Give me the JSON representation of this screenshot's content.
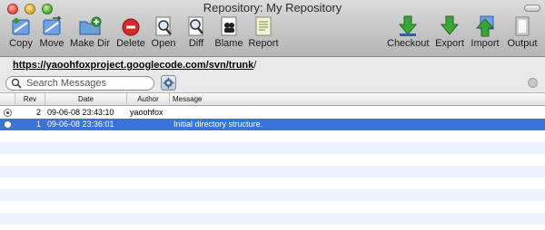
{
  "window": {
    "title": "Repository: My Repository"
  },
  "toolbar": {
    "left": [
      {
        "label": "Copy",
        "icon": "copy-icon"
      },
      {
        "label": "Move",
        "icon": "move-icon"
      },
      {
        "label": "Make Dir",
        "icon": "make-dir-icon"
      },
      {
        "label": "Delete",
        "icon": "delete-icon"
      },
      {
        "label": "Open",
        "icon": "open-icon"
      },
      {
        "label": "Diff",
        "icon": "diff-icon"
      },
      {
        "label": "Blame",
        "icon": "blame-icon"
      },
      {
        "label": "Report",
        "icon": "report-icon"
      }
    ],
    "right": [
      {
        "label": "Checkout",
        "icon": "checkout-icon"
      },
      {
        "label": "Export",
        "icon": "export-icon"
      },
      {
        "label": "Import",
        "icon": "import-icon"
      },
      {
        "label": "Output",
        "icon": "output-icon"
      }
    ]
  },
  "path": {
    "base": "https://yaoohfoxproject.googlecode.com/svn/",
    "segment": "trunk",
    "trail": "/"
  },
  "search": {
    "placeholder": "Search Messages",
    "value": ""
  },
  "table": {
    "columns": [
      "Rev",
      "Date",
      "Author",
      "Message"
    ],
    "rows": [
      {
        "rev": "2",
        "date": "09-06-08 23:43:10",
        "author": "yaoohfox",
        "message": "",
        "selected": false,
        "checked": true
      },
      {
        "rev": "1",
        "date": "09-06-08 23:36:01",
        "author": "",
        "message": "Initial directory structure.",
        "selected": true,
        "checked": false
      }
    ]
  },
  "colors": {
    "selection": "#3875d7",
    "stripe": "#edf3fe"
  }
}
